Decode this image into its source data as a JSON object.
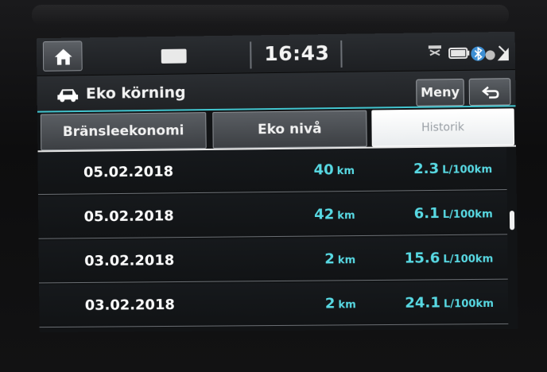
{
  "status_bar": {
    "clock": "16:43",
    "icons": [
      "home-icon",
      "screen-off-icon",
      "bluetooth-icon",
      "signal-icon"
    ]
  },
  "title_bar": {
    "title": "Eko körning",
    "menu_label": "Meny",
    "back_icon": "back-arrow-icon"
  },
  "tabs": [
    {
      "label": "Bränsleekonomi",
      "active": false
    },
    {
      "label": "Eko nivå",
      "active": false
    },
    {
      "label": "Historik",
      "active": true
    }
  ],
  "history": {
    "rows": [
      {
        "date": "05.02.2018",
        "distance": "40",
        "distance_unit": "km",
        "consumption": "2.3",
        "consumption_unit": "L/100km"
      },
      {
        "date": "05.02.2018",
        "distance": "42",
        "distance_unit": "km",
        "consumption": "6.1",
        "consumption_unit": "L/100km"
      },
      {
        "date": "03.02.2018",
        "distance": "2",
        "distance_unit": "km",
        "consumption": "15.6",
        "consumption_unit": "L/100km"
      },
      {
        "date": "03.02.2018",
        "distance": "2",
        "distance_unit": "km",
        "consumption": "24.1",
        "consumption_unit": "L/100km"
      }
    ]
  },
  "colors": {
    "accent": "#42c5cf",
    "value_text": "#58d9e3",
    "active_tab_bg": "#ffffff"
  }
}
